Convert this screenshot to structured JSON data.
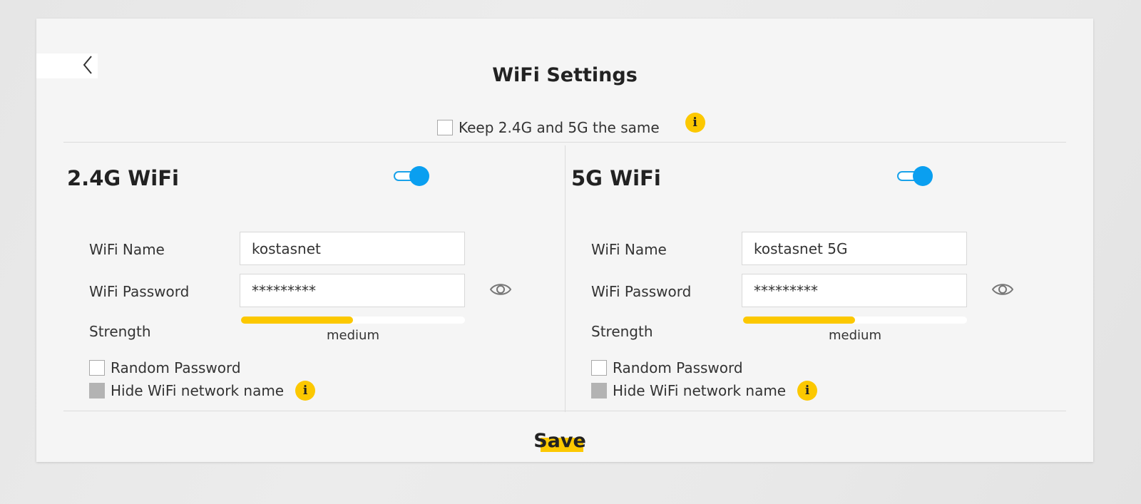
{
  "page": {
    "title": "WiFi Settings",
    "back_icon": "chevron-left-icon",
    "sync": {
      "label": "Keep 2.4G and 5G the same",
      "checked": false,
      "info_icon": "info-icon"
    },
    "save_label": "Save"
  },
  "colors": {
    "accent_yellow": "#fcc800",
    "toggle_blue": "#0a9ff0"
  },
  "bands": [
    {
      "title": "2.4G WiFi",
      "enabled": true,
      "name_label": "WiFi Name",
      "name_value": "kostasnet",
      "password_label": "WiFi Password",
      "password_value": "*********",
      "strength_label": "Strength",
      "strength_value": "medium",
      "strength_level": 0.5,
      "random_password_label": "Random Password",
      "random_password_checked": false,
      "hide_name_label": "Hide WiFi network name",
      "hide_name_disabled": true
    },
    {
      "title": "5G WiFi",
      "enabled": true,
      "name_label": "WiFi Name",
      "name_value": "kostasnet 5G",
      "password_label": "WiFi Password",
      "password_value": "*********",
      "strength_label": "Strength",
      "strength_value": "medium",
      "strength_level": 0.5,
      "random_password_label": "Random Password",
      "random_password_checked": false,
      "hide_name_label": "Hide WiFi network name",
      "hide_name_disabled": true
    }
  ]
}
